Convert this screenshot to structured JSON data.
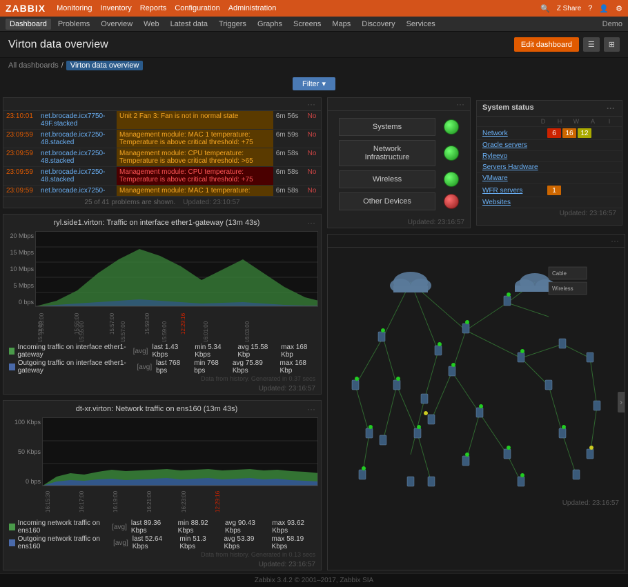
{
  "app": {
    "logo": "ZABBIX",
    "topnav": [
      "Monitoring",
      "Inventory",
      "Reports",
      "Configuration",
      "Administration"
    ],
    "topright": [
      "search",
      "share",
      "help",
      "user",
      "settings"
    ],
    "secondnav": [
      "Dashboard",
      "Problems",
      "Overview",
      "Web",
      "Latest data",
      "Triggers",
      "Graphs",
      "Screens",
      "Maps",
      "Discovery",
      "Services"
    ],
    "active_second": "Dashboard",
    "demo_label": "Demo",
    "footer": "Zabbix 3.4.2 © 2001–2017, Zabbix SIA"
  },
  "page": {
    "title": "Virton data overview",
    "breadcrumbs": [
      "All dashboards",
      "Virton data overview"
    ],
    "edit_btn": "Edit dashboard",
    "filter_btn": "Filter"
  },
  "problems_panel": {
    "three_dot": "···",
    "rows": [
      {
        "time": "23:10:01",
        "host": "net.brocade.icx7750-\n49F.stacked",
        "msg": "Unit 2 Fan 3: Fan is not in normal state",
        "dur": "6m 56s",
        "ack": "No",
        "color": "orange"
      },
      {
        "time": "23:09:59",
        "host": "net.brocade.icx7250-\n48.stacked",
        "msg": "Management module: MAC 1 temperature:\nTemperature is above critical threshold: +75",
        "dur": "6m 59s",
        "ack": "No",
        "color": "orange"
      },
      {
        "time": "23:09:59",
        "host": "net.brocade.icx7250-\n48.stacked",
        "msg": "Management module: CPU temperature:\nTemperature is above critical threshold: >65",
        "dur": "6m 58s",
        "ack": "No",
        "color": "orange"
      },
      {
        "time": "23:09:59",
        "host": "net.brocade.icx7250-\n48.stacked",
        "msg": "Management module: CPU temperature:\nTemperature is above critical threshold: +75",
        "dur": "6m 58s",
        "ack": "No",
        "color": "red"
      },
      {
        "time": "23:09:59",
        "host": "net.brocade.icx7250-",
        "msg": "Management module: MAC 1 temperature:",
        "dur": "6m 58s",
        "ack": "No",
        "color": "orange"
      }
    ],
    "footer": "25 of 41 problems are shown.",
    "updated": "Updated: 23:10:57"
  },
  "hostgroups_panel": {
    "three_dot": "···",
    "groups": [
      {
        "name": "Systems",
        "status": "green"
      },
      {
        "name": "Network Infrastructure",
        "status": "green"
      },
      {
        "name": "Wireless",
        "status": "green"
      },
      {
        "name": "Other Devices",
        "status": "red"
      }
    ],
    "updated": "Updated: 23:16:57"
  },
  "system_status": {
    "title": "System status",
    "three_dot": "···",
    "rows": [
      {
        "name": "Network",
        "bars": [
          {
            "val": "6",
            "type": "red"
          },
          {
            "val": "16",
            "type": "orange"
          },
          {
            "val": "12",
            "type": "yellow"
          }
        ]
      },
      {
        "name": "Oracle servers",
        "bars": []
      },
      {
        "name": "Ryleevo",
        "bars": []
      },
      {
        "name": "Servers Hardware",
        "bars": []
      },
      {
        "name": "VMware",
        "bars": []
      },
      {
        "name": "WFR servers",
        "bars": [
          {
            "val": "1",
            "type": "orange"
          }
        ]
      },
      {
        "name": "Websites",
        "bars": []
      }
    ],
    "updated": "Updated: 23:16:57"
  },
  "chart1": {
    "title": "ryl.side1.virton: Traffic on interface ether1-gateway (13m 43s)",
    "three_dot": "···",
    "y_labels": [
      "20 Mbps",
      "15 Mbps",
      "10 Mbps",
      "5 Mbps",
      "0 bps"
    ],
    "legend": [
      {
        "label": "Incoming traffic on interface ether1-gateway",
        "avg_label": "[avg]",
        "last": "1.43 Kbps",
        "min": "5.34 Kbps",
        "avg": "15.58 Kbp",
        "max": "168 Kbp"
      },
      {
        "label": "Outgoing traffic on interface ether1-gateway",
        "avg_label": "[avg]",
        "last": "768 bps",
        "min": "768 bps",
        "avg": "75.89 Kbps",
        "max": "168 Kbp"
      }
    ],
    "data_note": "Data from history. Generated in 0.37 secs",
    "updated": "Updated: 23:16:57"
  },
  "chart2": {
    "title": "dt-xr.virton: Network traffic on ens160 (13m 43s)",
    "three_dot": "···",
    "y_labels": [
      "100 Kbps",
      "50 Kbps",
      "0 bps"
    ],
    "legend": [
      {
        "label": "Incoming network traffic on ens160",
        "avg_label": "[avg]",
        "last": "89.36 Kbps",
        "min": "88.92 Kbps",
        "avg": "90.43 Kbps",
        "max": "93.62 Kbps"
      },
      {
        "label": "Outgoing network traffic on ens160",
        "avg_label": "[avg]",
        "last": "52.64 Kbps",
        "min": "51.3 Kbps",
        "avg": "53.39 Kbps",
        "max": "58.19 Kbps"
      }
    ],
    "data_note": "Data from history. Generated in 0.13 secs",
    "updated": "Updated: 23:16:57"
  },
  "map_panel": {
    "updated": "Updated: 23:16:57",
    "side_arrow": "›"
  },
  "colors": {
    "accent": "#d4531a",
    "link": "#6ab0f5",
    "bg_dark": "#1a1a1a",
    "bg_panel": "#222222",
    "border": "#333333"
  }
}
